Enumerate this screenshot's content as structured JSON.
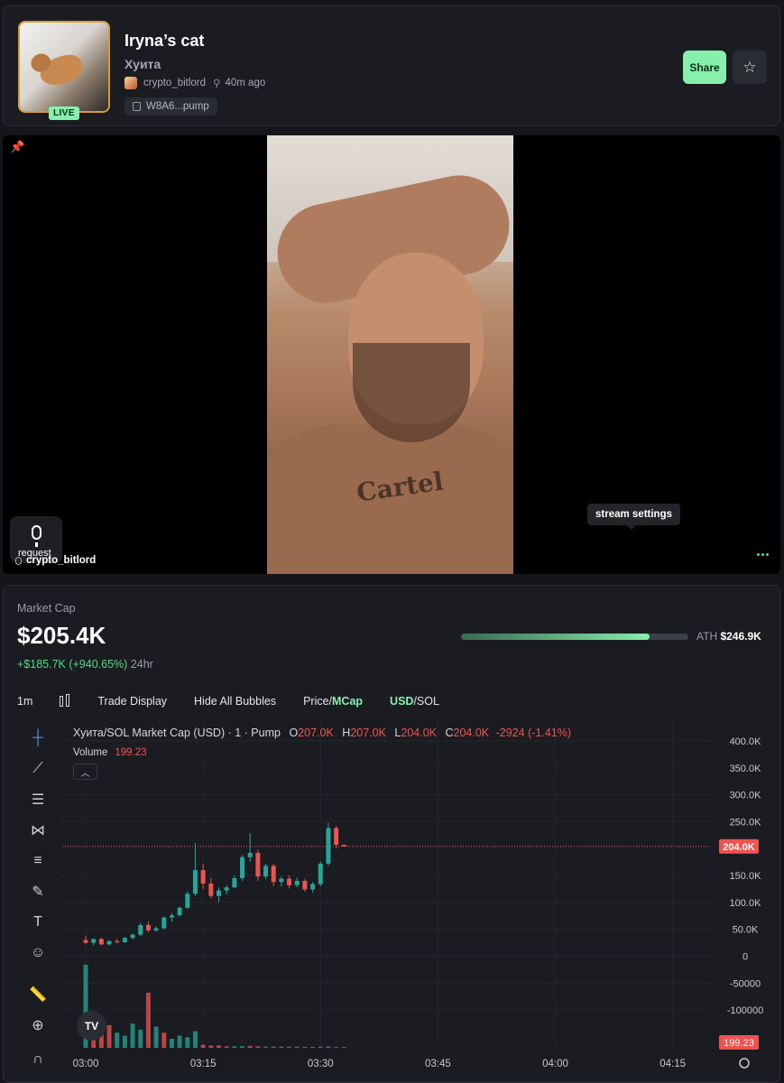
{
  "token": {
    "title": "Iryna’s cat",
    "ticker": "Хуита",
    "live_label": "LIVE",
    "creator": "crypto_bitlord",
    "age": "40m ago",
    "contract_short": "W8A6...pump"
  },
  "header_actions": {
    "share_label": "Share",
    "star_icon": "star-icon"
  },
  "stream": {
    "request_label": "request",
    "streamer_name": "crypto_bitlord",
    "settings_tooltip": "stream settings",
    "tattoo_text": "Cartel"
  },
  "market": {
    "label": "Market Cap",
    "value": "$205.4K",
    "change_abs": "+$185.7K",
    "change_pct": "(+940.65%)",
    "change_period": "24hr",
    "ath_label": "ATH",
    "ath_value": "$246.9K",
    "ath_progress": 0.83
  },
  "toolbar": {
    "interval": "1m",
    "trade_display": "Trade Display",
    "hide_bubbles": "Hide All Bubbles",
    "price_label": "Price/",
    "mcap_label": "MCap",
    "usd_label": "USD",
    "sol_label": "/SOL"
  },
  "chart_header": {
    "pair": "Хуита/SOL Market Cap (USD) · 1 · Pump",
    "o_label": "O",
    "o_value": "207.0K",
    "h_label": "H",
    "h_value": "207.0K",
    "l_label": "L",
    "l_value": "204.0K",
    "c_label": "C",
    "c_value": "204.0K",
    "change": "-2924 (-1.41%)",
    "volume_label": "Volume",
    "volume_value": "199.23",
    "logo_text": "TV"
  },
  "colors": {
    "up": "#26a69a",
    "down": "#ef5350",
    "accent": "#86efac",
    "bg": "#1b1c22"
  },
  "chart_data": {
    "type": "candlestick",
    "y_ticks": [
      "400.0K",
      "350.0K",
      "300.0K",
      "250.0K",
      "150.0K",
      "100.0K",
      "50.0K",
      "0",
      "-50000",
      "-100000"
    ],
    "y_tick_values": [
      400000,
      350000,
      300000,
      250000,
      150000,
      100000,
      50000,
      0,
      -50000,
      -100000
    ],
    "x_ticks": [
      "03:00",
      "03:15",
      "03:30",
      "03:45",
      "04:00",
      "04:15"
    ],
    "x_tick_minutes": [
      0,
      15,
      30,
      45,
      60,
      75
    ],
    "ylim": [
      -150000,
      420000
    ],
    "xlim": [
      -3,
      80
    ],
    "last_price_label": "204.0K",
    "last_price": 204000,
    "last_volume_label": "199.23",
    "candles": [
      [
        0,
        30000,
        38000,
        22000,
        25000
      ],
      [
        1,
        25000,
        33000,
        20000,
        32000
      ],
      [
        2,
        32000,
        34000,
        20000,
        22000
      ],
      [
        3,
        22000,
        30000,
        20000,
        28000
      ],
      [
        4,
        28000,
        32000,
        24000,
        26000
      ],
      [
        5,
        26000,
        36000,
        25000,
        34000
      ],
      [
        6,
        34000,
        42000,
        31000,
        40000
      ],
      [
        7,
        40000,
        62000,
        38000,
        58000
      ],
      [
        8,
        58000,
        65000,
        44000,
        48000
      ],
      [
        9,
        48000,
        56000,
        45000,
        52000
      ],
      [
        10,
        52000,
        74000,
        50000,
        72000
      ],
      [
        11,
        72000,
        80000,
        64000,
        76000
      ],
      [
        12,
        76000,
        92000,
        74000,
        90000
      ],
      [
        13,
        90000,
        120000,
        88000,
        116000
      ],
      [
        14,
        116000,
        210000,
        112000,
        160000
      ],
      [
        15,
        160000,
        172000,
        125000,
        135000
      ],
      [
        16,
        135000,
        145000,
        108000,
        112000
      ],
      [
        17,
        112000,
        128000,
        100000,
        122000
      ],
      [
        18,
        122000,
        132000,
        115000,
        128000
      ],
      [
        19,
        128000,
        150000,
        126000,
        145000
      ],
      [
        20,
        145000,
        188000,
        140000,
        184000
      ],
      [
        21,
        184000,
        228000,
        175000,
        192000
      ],
      [
        22,
        192000,
        198000,
        140000,
        148000
      ],
      [
        23,
        148000,
        172000,
        143000,
        168000
      ],
      [
        24,
        168000,
        172000,
        130000,
        138000
      ],
      [
        25,
        138000,
        148000,
        130000,
        144000
      ],
      [
        26,
        144000,
        150000,
        126000,
        132000
      ],
      [
        27,
        132000,
        146000,
        128000,
        140000
      ],
      [
        28,
        140000,
        144000,
        120000,
        124000
      ],
      [
        29,
        124000,
        138000,
        118000,
        134000
      ],
      [
        30,
        134000,
        176000,
        130000,
        172000
      ],
      [
        31,
        172000,
        248000,
        168000,
        238000
      ],
      [
        32,
        238000,
        242000,
        200000,
        207000
      ],
      [
        33,
        207000,
        207000,
        204000,
        204000
      ]
    ],
    "volumes": [
      [
        0,
        1100,
        "up"
      ],
      [
        1,
        380,
        "down"
      ],
      [
        2,
        270,
        "down"
      ],
      [
        3,
        300,
        "down"
      ],
      [
        4,
        200,
        "up"
      ],
      [
        5,
        160,
        "up"
      ],
      [
        6,
        320,
        "up"
      ],
      [
        7,
        240,
        "up"
      ],
      [
        8,
        730,
        "down"
      ],
      [
        9,
        280,
        "up"
      ],
      [
        10,
        200,
        "down"
      ],
      [
        11,
        120,
        "up"
      ],
      [
        12,
        160,
        "up"
      ],
      [
        13,
        140,
        "up"
      ],
      [
        14,
        220,
        "up"
      ],
      [
        15,
        40,
        "down"
      ],
      [
        16,
        30,
        "down"
      ],
      [
        17,
        30,
        "down"
      ],
      [
        18,
        20,
        "down"
      ],
      [
        19,
        20,
        "up"
      ],
      [
        20,
        20,
        "up"
      ],
      [
        21,
        25,
        "down"
      ],
      [
        22,
        20,
        "down"
      ],
      [
        23,
        15,
        "up"
      ],
      [
        24,
        15,
        "down"
      ],
      [
        25,
        15,
        "down"
      ],
      [
        26,
        15,
        "down"
      ],
      [
        27,
        15,
        "up"
      ],
      [
        28,
        12,
        "down"
      ],
      [
        29,
        12,
        "down"
      ],
      [
        30,
        14,
        "up"
      ],
      [
        31,
        18,
        "up"
      ],
      [
        32,
        10,
        "down"
      ],
      [
        33,
        10,
        "down"
      ]
    ]
  }
}
